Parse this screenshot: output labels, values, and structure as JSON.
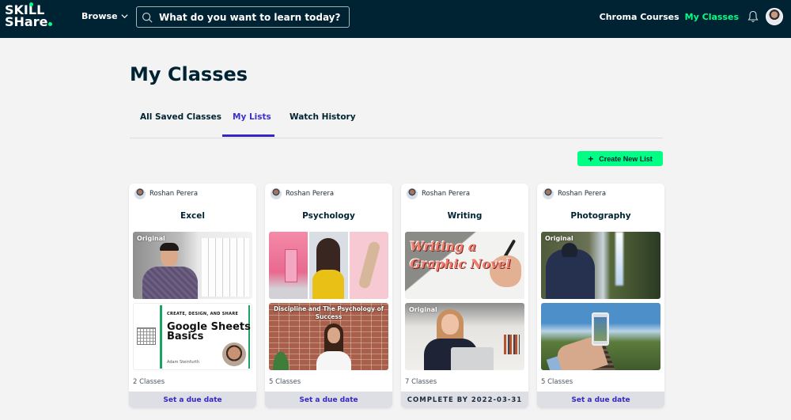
{
  "header": {
    "logo_line1": "SKILL",
    "logo_line2": "SHare",
    "browse_label": "Browse",
    "search_placeholder": "What do you want to learn today?",
    "nav_chroma": "Chroma Courses",
    "nav_my_classes": "My Classes",
    "colors": {
      "bar": "#002333",
      "accent": "#00ff84"
    }
  },
  "page": {
    "title": "My Classes",
    "tabs": [
      {
        "label": "All Saved Classes",
        "active": false
      },
      {
        "label": "My Lists",
        "active": true
      },
      {
        "label": "Watch History",
        "active": false
      }
    ],
    "create_button": "Create New List",
    "colors": {
      "active_tab": "#3526c6",
      "button": "#00ff84"
    }
  },
  "lists": [
    {
      "owner": "Roshan Perera",
      "title": "Excel",
      "thumbnails": [
        {
          "badge": "Original"
        },
        {
          "kicker": "CREATE, DESIGN, AND SHARE",
          "title": "Google Sheets Basics",
          "author": "Adam Steinfurth"
        }
      ],
      "count": "2 Classes",
      "footer": "Set a due date"
    },
    {
      "owner": "Roshan Perera",
      "title": "Psychology",
      "thumbnails": [
        {
          "badge": ""
        },
        {
          "title": "Discipline and The Psychology of Success"
        }
      ],
      "count": "5 Classes",
      "footer": "Set a due date"
    },
    {
      "owner": "Roshan Perera",
      "title": "Writing",
      "thumbnails": [
        {
          "title": "Writing a Graphic Novel"
        },
        {
          "badge": "Original"
        }
      ],
      "count": "7 Classes",
      "footer": "COMPLETE BY 2022-03-31"
    },
    {
      "owner": "Roshan Perera",
      "title": "Photography",
      "thumbnails": [
        {
          "badge": "Original"
        },
        {
          "badge": ""
        }
      ],
      "count": "5 Classes",
      "footer": "Set a due date"
    }
  ]
}
